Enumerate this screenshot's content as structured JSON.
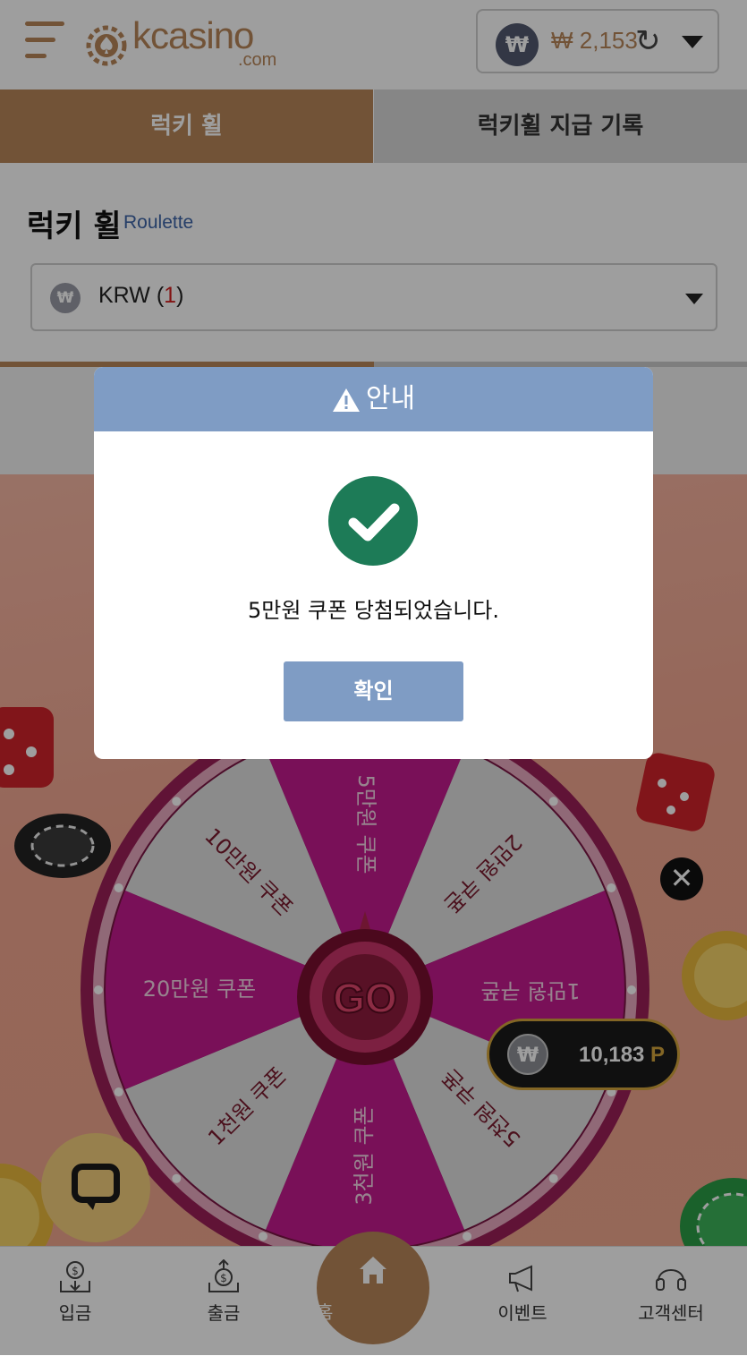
{
  "header": {
    "logo_text": "kcasino",
    "logo_sub": ".com",
    "wallet_symbol": "₩",
    "wallet_amount": "₩ 2,153"
  },
  "tabs": [
    {
      "label": "럭키 휠",
      "active": true
    },
    {
      "label": "럭키휠 지급 기록",
      "active": false
    }
  ],
  "section": {
    "title": "럭키 휠",
    "subtitle": "Roulette",
    "select_currency": "KRW (",
    "select_count": "1",
    "select_close": ")",
    "progress": 0.5
  },
  "wheel": {
    "center_label": "GO",
    "segments": [
      {
        "label": "5만원 쿠폰",
        "color": "#c41a8f"
      },
      {
        "label": "2만원 쿠폰",
        "color": "#e0e0e0"
      },
      {
        "label": "1만원 쿠폰",
        "color": "#c41a8f"
      },
      {
        "label": "5천원 쿠폰",
        "color": "#e0e0e0"
      },
      {
        "label": "3천원 쿠폰",
        "color": "#c41a8f"
      },
      {
        "label": "1천원 쿠폰",
        "color": "#e0e0e0"
      },
      {
        "label": "20만원 쿠폰",
        "color": "#c41a8f"
      },
      {
        "label": "10만원 쿠폰",
        "color": "#e0e0e0"
      }
    ]
  },
  "points": {
    "value": "10,183",
    "unit": "P"
  },
  "bottom_nav": [
    {
      "label": "입금",
      "icon": "deposit-icon"
    },
    {
      "label": "출금",
      "icon": "withdraw-icon"
    },
    {
      "label": "홈",
      "icon": "home-icon"
    },
    {
      "label": "이벤트",
      "icon": "megaphone-icon"
    },
    {
      "label": "고객센터",
      "icon": "headset-icon"
    }
  ],
  "modal": {
    "title": "안내",
    "message": "5만원 쿠폰 당첨되었습니다.",
    "confirm_label": "확인"
  },
  "colors": {
    "brand": "#b9875a",
    "modal_header": "#7f9cc4",
    "success": "#1d7b57"
  }
}
